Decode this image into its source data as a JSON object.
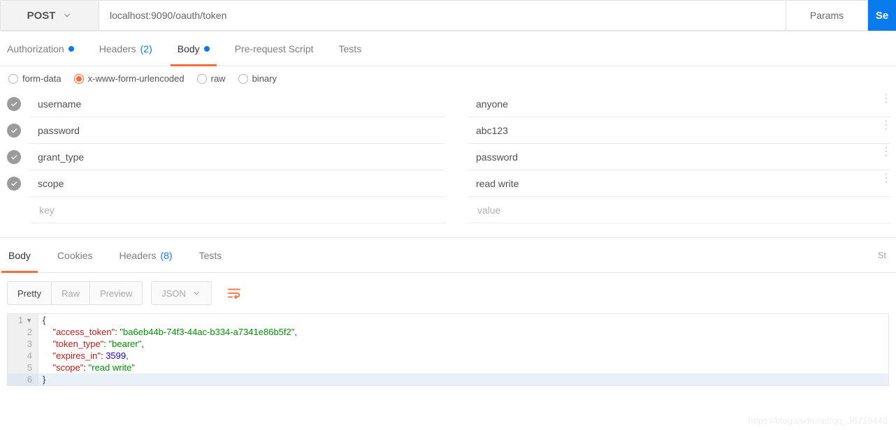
{
  "request": {
    "method": "POST",
    "url": "localhost:9090/oauth/token",
    "params_btn": "Params",
    "send_btn": "Se"
  },
  "tabs": {
    "authorization": "Authorization",
    "headers": "Headers",
    "headers_count": "(2)",
    "body": "Body",
    "prerequest": "Pre-request Script",
    "tests": "Tests"
  },
  "body_types": {
    "formdata": "form-data",
    "urlencoded": "x-www-form-urlencoded",
    "raw": "raw",
    "binary": "binary"
  },
  "form": {
    "rows": [
      {
        "key": "username",
        "value": "anyone"
      },
      {
        "key": "password",
        "value": "abc123"
      },
      {
        "key": "grant_type",
        "value": "password"
      },
      {
        "key": "scope",
        "value": "read write"
      }
    ],
    "key_placeholder": "key",
    "value_placeholder": "value"
  },
  "response_tabs": {
    "body": "Body",
    "cookies": "Cookies",
    "headers": "Headers",
    "headers_count": "(8)",
    "tests": "Tests",
    "status_label": "St"
  },
  "resp_toolbar": {
    "pretty": "Pretty",
    "raw": "Raw",
    "preview": "Preview",
    "json": "JSON"
  },
  "response_json": {
    "access_token": "ba6eb44b-74f3-44ac-b334-a7341e86b5f2",
    "token_type": "bearer",
    "expires_in": 3599,
    "scope": "read write"
  },
  "watermark": "https://blog.csdn.net/qq_36719449"
}
